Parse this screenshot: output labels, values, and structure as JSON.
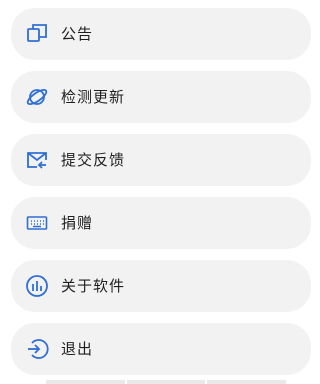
{
  "accent_color": "#2f6fd6",
  "menu": {
    "items": [
      {
        "label": "公告",
        "icon": "announcement-icon"
      },
      {
        "label": "检测更新",
        "icon": "update-check-icon"
      },
      {
        "label": "提交反馈",
        "icon": "feedback-mail-icon"
      },
      {
        "label": "捐赠",
        "icon": "keyboard-icon"
      },
      {
        "label": "关于软件",
        "icon": "about-chart-icon"
      },
      {
        "label": "退出",
        "icon": "logout-icon"
      }
    ]
  }
}
